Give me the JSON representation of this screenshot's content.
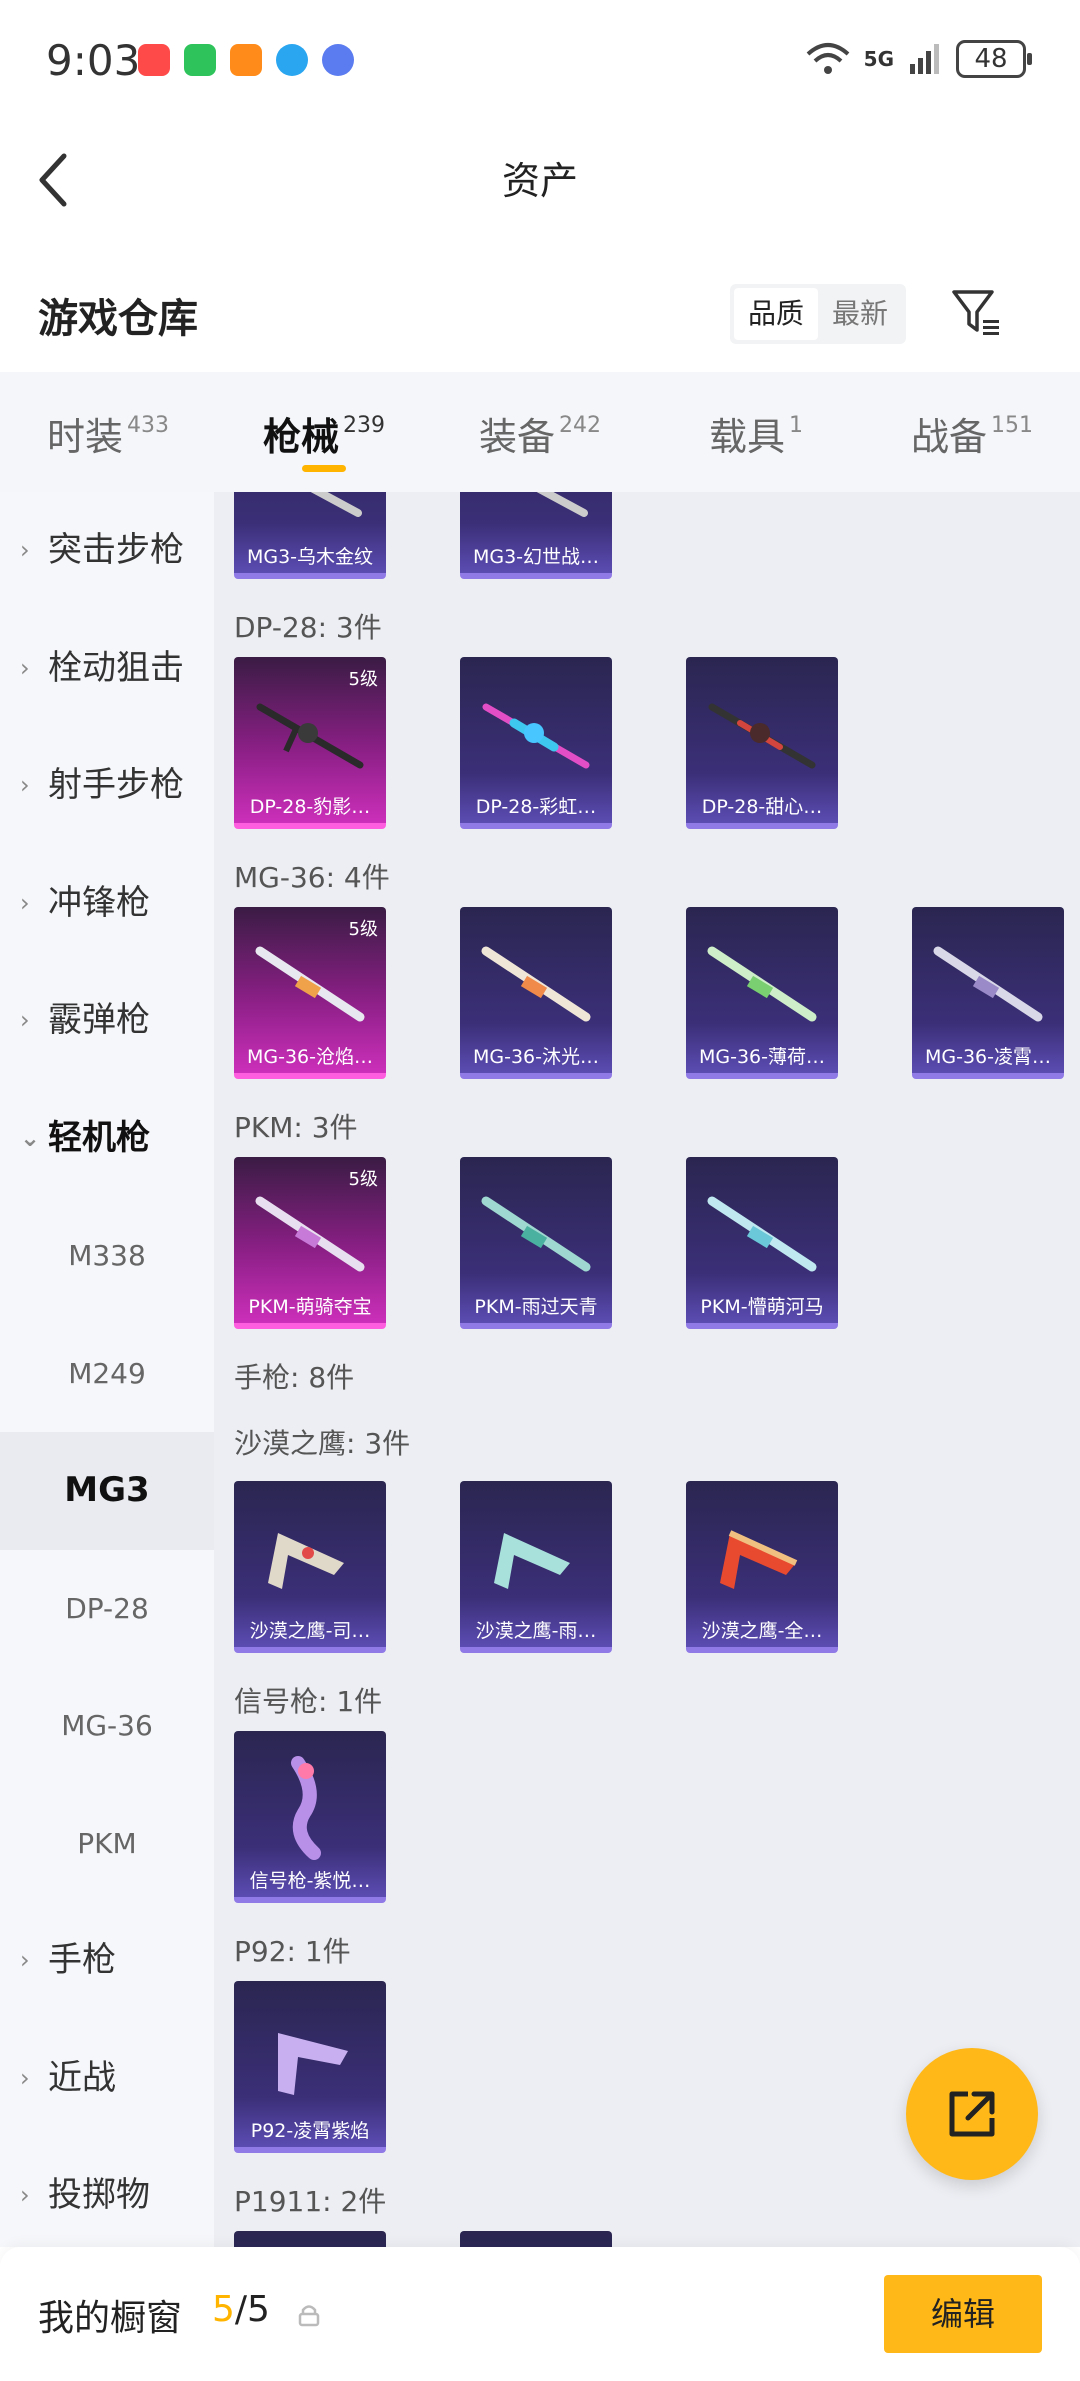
{
  "status_bar": {
    "time": "9:03",
    "network": "5G",
    "battery": "48"
  },
  "header": {
    "title": "资产"
  },
  "subheader": {
    "title": "游戏仓库",
    "sort_quality": "品质",
    "sort_newest": "最新"
  },
  "tabs": [
    {
      "label": "时装",
      "count": "433"
    },
    {
      "label": "枪械",
      "count": "239"
    },
    {
      "label": "装备",
      "count": "242"
    },
    {
      "label": "载具",
      "count": "1"
    },
    {
      "label": "战备",
      "count": "151"
    }
  ],
  "sidebar": {
    "categories": [
      "突击步枪",
      "栓动狙击",
      "射手步枪",
      "冲锋枪",
      "霰弹枪",
      "轻机枪"
    ],
    "sub_items": [
      "M338",
      "M249",
      "MG3",
      "DP-28",
      "MG-36",
      "PKM"
    ],
    "more": [
      "手枪",
      "近战",
      "投掷物"
    ]
  },
  "content": {
    "top_cards": [
      "MG3-乌木金纹",
      "MG3-幻世战…"
    ],
    "groups": [
      {
        "label": "DP-28: 3件",
        "items": [
          {
            "name": "DP-28-豹影…",
            "level": "5级"
          },
          {
            "name": "DP-28-彩虹…",
            "level": ""
          },
          {
            "name": "DP-28-甜心…",
            "level": ""
          }
        ]
      },
      {
        "label": "MG-36: 4件",
        "items": [
          {
            "name": "MG-36-沧焰…",
            "level": "5级"
          },
          {
            "name": "MG-36-沐光…",
            "level": ""
          },
          {
            "name": "MG-36-薄荷…",
            "level": ""
          },
          {
            "name": "MG-36-凌霄…",
            "level": ""
          }
        ]
      },
      {
        "label": "PKM: 3件",
        "items": [
          {
            "name": "PKM-萌骑夺宝",
            "level": "5级"
          },
          {
            "name": "PKM-雨过天青",
            "level": ""
          },
          {
            "name": "PKM-懵萌河马",
            "level": ""
          }
        ]
      }
    ],
    "section_pistol": "手枪: 8件",
    "pistol_groups": [
      {
        "label": "沙漠之鹰: 3件",
        "items": [
          {
            "name": "沙漠之鹰-司…",
            "level": ""
          },
          {
            "name": "沙漠之鹰-雨…",
            "level": ""
          },
          {
            "name": "沙漠之鹰-全…",
            "level": ""
          }
        ]
      },
      {
        "label": "信号枪: 1件",
        "items": [
          {
            "name": "信号枪-紫悦…",
            "level": ""
          }
        ]
      },
      {
        "label": "P92: 1件",
        "items": [
          {
            "name": "P92-凌霄紫焰",
            "level": ""
          }
        ]
      },
      {
        "label": "P1911: 2件",
        "items": []
      }
    ]
  },
  "bottom": {
    "label": "我的橱窗",
    "count_current": "5",
    "count_total": "/5",
    "edit": "编辑"
  },
  "colors": {
    "accent": "#ffb818",
    "legendary": "#cc2fba",
    "epic": "#5b4cb2"
  }
}
